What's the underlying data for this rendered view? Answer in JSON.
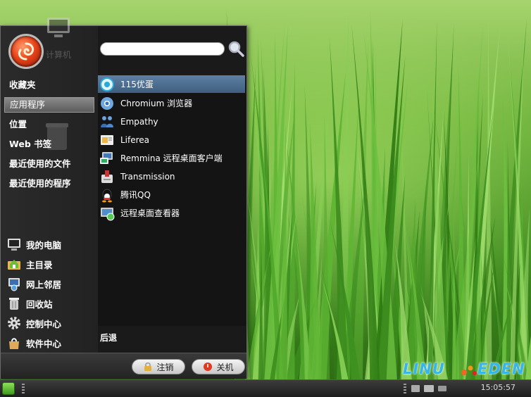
{
  "search": {
    "placeholder": "",
    "value": ""
  },
  "ghost_desktop": {
    "computer_label": "计算机"
  },
  "categories": [
    {
      "label": "收藏夹",
      "active": false
    },
    {
      "label": "应用程序",
      "active": true
    },
    {
      "label": "位置",
      "active": false
    },
    {
      "label": "Web 书签",
      "active": false
    },
    {
      "label": "最近使用的文件",
      "active": false
    },
    {
      "label": "最近使用的程序",
      "active": false
    }
  ],
  "places": [
    {
      "label": "我的电脑",
      "icon": "monitor-icon"
    },
    {
      "label": "主目录",
      "icon": "home-folder-icon"
    },
    {
      "label": "网上邻居",
      "icon": "network-icon"
    },
    {
      "label": "回收站",
      "icon": "trash-icon"
    },
    {
      "label": "控制中心",
      "icon": "gear-icon"
    },
    {
      "label": "软件中心",
      "icon": "software-bag-icon"
    }
  ],
  "apps": [
    {
      "label": "115优蛋",
      "icon": "115-egg-icon",
      "selected": true
    },
    {
      "label": "Chromium 浏览器",
      "icon": "chromium-icon",
      "selected": false
    },
    {
      "label": "Empathy",
      "icon": "empathy-icon",
      "selected": false
    },
    {
      "label": "Liferea",
      "icon": "liferea-icon",
      "selected": false
    },
    {
      "label": "Remmina 远程桌面客户端",
      "icon": "remmina-icon",
      "selected": false
    },
    {
      "label": "Transmission",
      "icon": "transmission-icon",
      "selected": false
    },
    {
      "label": "腾讯QQ",
      "icon": "qq-penguin-icon",
      "selected": false
    },
    {
      "label": "远程桌面查看器",
      "icon": "remote-viewer-icon",
      "selected": false
    }
  ],
  "back_label": "后退",
  "buttons": {
    "logout": "注销",
    "shutdown": "关机"
  },
  "watermark": {
    "left": "LINU",
    "right": "EDEN"
  },
  "taskbar": {
    "clock": "15:05:57"
  },
  "colors": {
    "selection": "#4f7194",
    "menu_bg": "#1a1a1a",
    "watermark": "#35b6ea"
  }
}
